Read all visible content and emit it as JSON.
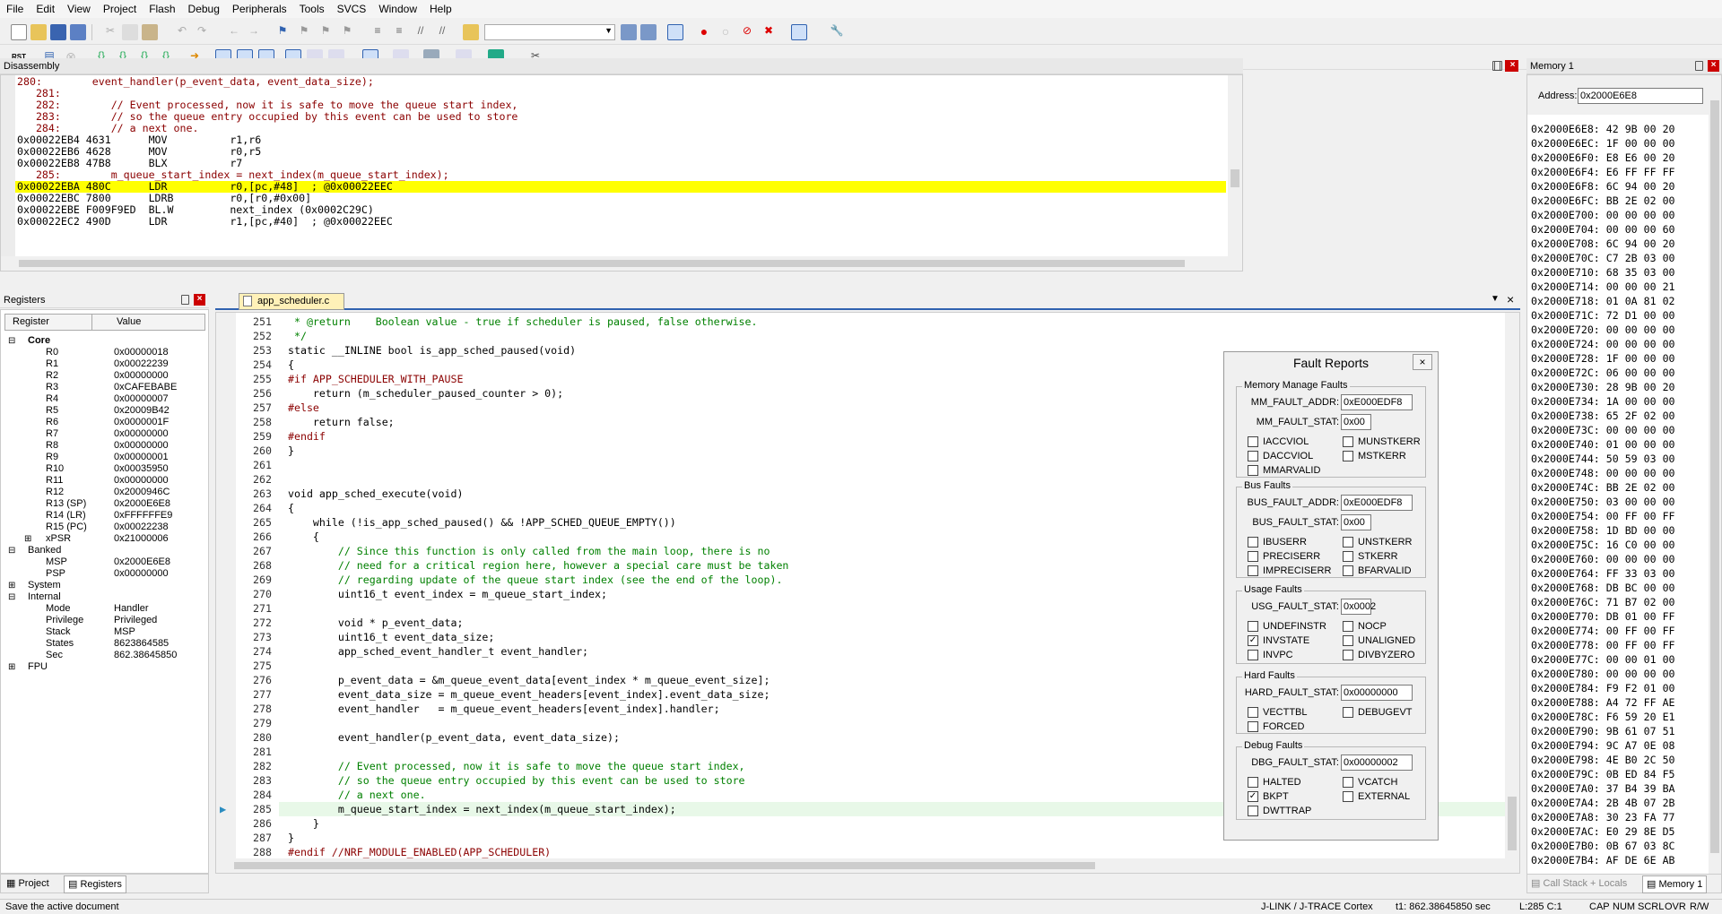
{
  "menu": [
    "File",
    "Edit",
    "View",
    "Project",
    "Flash",
    "Debug",
    "Peripherals",
    "Tools",
    "SVCS",
    "Window",
    "Help"
  ],
  "disassembly": {
    "title": "Disassembly",
    "lines": [
      {
        "t": "280:        event_handler(p_event_data, event_data_size);",
        "c": "cd"
      },
      {
        "t": "   281:",
        "c": "cd"
      },
      {
        "t": "   282:        // Event processed, now it is safe to move the queue start index,",
        "c": "cd"
      },
      {
        "t": "   283:        // so the queue entry occupied by this event can be used to store",
        "c": "cd"
      },
      {
        "t": "   284:        // a next one.",
        "c": "cd"
      },
      {
        "t": "0x00022EB4 4631      MOV          r1,r6",
        "c": ""
      },
      {
        "t": "0x00022EB6 4628      MOV          r0,r5",
        "c": ""
      },
      {
        "t": "0x00022EB8 47B8      BLX          r7",
        "c": ""
      },
      {
        "t": "   285:        m_queue_start_index = next_index(m_queue_start_index);",
        "c": "cd"
      },
      {
        "t": "0x00022EBA 480C      LDR          r0,[pc,#48]  ; @0x00022EEC",
        "c": "hl"
      },
      {
        "t": "0x00022EBC 7800      LDRB         r0,[r0,#0x00]",
        "c": ""
      },
      {
        "t": "0x00022EBE F009F9ED  BL.W         next_index (0x0002C29C)",
        "c": ""
      },
      {
        "t": "0x00022EC2 490D      LDR          r1,[pc,#40]  ; @0x00022EEC",
        "c": ""
      }
    ]
  },
  "registers": {
    "title": "Registers",
    "col_register": "Register",
    "col_value": "Value",
    "rows": [
      {
        "n": "Core",
        "v": "",
        "lvl": 0,
        "bold": true,
        "exp": "-"
      },
      {
        "n": "R0",
        "v": "0x00000018",
        "lvl": 1
      },
      {
        "n": "R1",
        "v": "0x00022239",
        "lvl": 1
      },
      {
        "n": "R2",
        "v": "0x00000000",
        "lvl": 1
      },
      {
        "n": "R3",
        "v": "0xCAFEBABE",
        "lvl": 1
      },
      {
        "n": "R4",
        "v": "0x00000007",
        "lvl": 1
      },
      {
        "n": "R5",
        "v": "0x20009B42",
        "lvl": 1
      },
      {
        "n": "R6",
        "v": "0x0000001F",
        "lvl": 1
      },
      {
        "n": "R7",
        "v": "0x00000000",
        "lvl": 1
      },
      {
        "n": "R8",
        "v": "0x00000000",
        "lvl": 1
      },
      {
        "n": "R9",
        "v": "0x00000001",
        "lvl": 1
      },
      {
        "n": "R10",
        "v": "0x00035950",
        "lvl": 1
      },
      {
        "n": "R11",
        "v": "0x00000000",
        "lvl": 1
      },
      {
        "n": "R12",
        "v": "0x2000946C",
        "lvl": 1
      },
      {
        "n": "R13 (SP)",
        "v": "0x2000E6E8",
        "lvl": 1
      },
      {
        "n": "R14 (LR)",
        "v": "0xFFFFFFE9",
        "lvl": 1
      },
      {
        "n": "R15 (PC)",
        "v": "0x00022238",
        "lvl": 1
      },
      {
        "n": "xPSR",
        "v": "0x21000006",
        "lvl": 1,
        "exp": "+"
      },
      {
        "n": "Banked",
        "v": "",
        "lvl": 0,
        "exp": "-"
      },
      {
        "n": "MSP",
        "v": "0x2000E6E8",
        "lvl": 1
      },
      {
        "n": "PSP",
        "v": "0x00000000",
        "lvl": 1
      },
      {
        "n": "System",
        "v": "",
        "lvl": 0,
        "exp": "+"
      },
      {
        "n": "Internal",
        "v": "",
        "lvl": 0,
        "exp": "-"
      },
      {
        "n": "Mode",
        "v": "Handler",
        "lvl": 1
      },
      {
        "n": "Privilege",
        "v": "Privileged",
        "lvl": 1
      },
      {
        "n": "Stack",
        "v": "MSP",
        "lvl": 1
      },
      {
        "n": "States",
        "v": "8623864585",
        "lvl": 1
      },
      {
        "n": "Sec",
        "v": "862.38645850",
        "lvl": 1
      },
      {
        "n": "FPU",
        "v": "",
        "lvl": 0,
        "exp": "+"
      }
    ],
    "tab_project": "Project",
    "tab_registers": "Registers"
  },
  "editor": {
    "tab": "app_scheduler.c",
    "lines": [
      {
        "n": "251",
        "h": " * @return    Boolean value - true if scheduler is paused, false otherwise.",
        "k": "cmt"
      },
      {
        "n": "252",
        "h": " */",
        "k": "cmt"
      },
      {
        "n": "253",
        "h": "static __INLINE bool is_app_sched_paused(void)",
        "k": ""
      },
      {
        "n": "254",
        "h": "{",
        "k": ""
      },
      {
        "n": "255",
        "h": "#if APP_SCHEDULER_WITH_PAUSE",
        "k": "pp"
      },
      {
        "n": "256",
        "h": "    return (m_scheduler_paused_counter > 0);",
        "k": ""
      },
      {
        "n": "257",
        "h": "#else",
        "k": "pp"
      },
      {
        "n": "258",
        "h": "    return false;",
        "k": ""
      },
      {
        "n": "259",
        "h": "#endif",
        "k": "pp"
      },
      {
        "n": "260",
        "h": "}",
        "k": ""
      },
      {
        "n": "261",
        "h": "",
        "k": ""
      },
      {
        "n": "262",
        "h": "",
        "k": ""
      },
      {
        "n": "263",
        "h": "void app_sched_execute(void)",
        "k": ""
      },
      {
        "n": "264",
        "h": "{",
        "k": ""
      },
      {
        "n": "265",
        "h": "    while (!is_app_sched_paused() && !APP_SCHED_QUEUE_EMPTY())",
        "k": ""
      },
      {
        "n": "266",
        "h": "    {",
        "k": ""
      },
      {
        "n": "267",
        "h": "        // Since this function is only called from the main loop, there is no",
        "k": "cmt"
      },
      {
        "n": "268",
        "h": "        // need for a critical region here, however a special care must be taken",
        "k": "cmt"
      },
      {
        "n": "269",
        "h": "        // regarding update of the queue start index (see the end of the loop).",
        "k": "cmt"
      },
      {
        "n": "270",
        "h": "        uint16_t event_index = m_queue_start_index;",
        "k": ""
      },
      {
        "n": "271",
        "h": "",
        "k": ""
      },
      {
        "n": "272",
        "h": "        void * p_event_data;",
        "k": ""
      },
      {
        "n": "273",
        "h": "        uint16_t event_data_size;",
        "k": ""
      },
      {
        "n": "274",
        "h": "        app_sched_event_handler_t event_handler;",
        "k": ""
      },
      {
        "n": "275",
        "h": "",
        "k": ""
      },
      {
        "n": "276",
        "h": "        p_event_data = &m_queue_event_data[event_index * m_queue_event_size];",
        "k": ""
      },
      {
        "n": "277",
        "h": "        event_data_size = m_queue_event_headers[event_index].event_data_size;",
        "k": ""
      },
      {
        "n": "278",
        "h": "        event_handler   = m_queue_event_headers[event_index].handler;",
        "k": ""
      },
      {
        "n": "279",
        "h": "",
        "k": ""
      },
      {
        "n": "280",
        "h": "        event_handler(p_event_data, event_data_size);",
        "k": ""
      },
      {
        "n": "281",
        "h": "",
        "k": ""
      },
      {
        "n": "282",
        "h": "        // Event processed, now it is safe to move the queue start index,",
        "k": "cmt"
      },
      {
        "n": "283",
        "h": "        // so the queue entry occupied by this event can be used to store",
        "k": "cmt"
      },
      {
        "n": "284",
        "h": "        // a next one.",
        "k": "cmt"
      },
      {
        "n": "285",
        "h": "        m_queue_start_index = next_index(m_queue_start_index);",
        "k": "cur"
      },
      {
        "n": "286",
        "h": "    }",
        "k": ""
      },
      {
        "n": "287",
        "h": "}",
        "k": ""
      },
      {
        "n": "288",
        "h": "#endif //NRF_MODULE_ENABLED(APP_SCHEDULER)",
        "k": "pp"
      },
      {
        "n": "289",
        "h": "",
        "k": ""
      }
    ]
  },
  "memory": {
    "title": "Memory 1",
    "address_label": "Address:",
    "address_value": "0x2000E6E8",
    "rows": [
      "0x2000E6E8: 42 9B 00 20",
      "0x2000E6EC: 1F 00 00 00",
      "0x2000E6F0: E8 E6 00 20",
      "0x2000E6F4: E6 FF FF FF",
      "0x2000E6F8: 6C 94 00 20",
      "0x2000E6FC: BB 2E 02 00",
      "0x2000E700: 00 00 00 00",
      "0x2000E704: 00 00 00 60",
      "0x2000E708: 6C 94 00 20",
      "0x2000E70C: C7 2B 03 00",
      "0x2000E710: 68 35 03 00",
      "0x2000E714: 00 00 00 21",
      "0x2000E718: 01 0A 81 02",
      "0x2000E71C: 72 D1 00 00",
      "0x2000E720: 00 00 00 00",
      "0x2000E724: 00 00 00 00",
      "0x2000E728: 1F 00 00 00",
      "0x2000E72C: 06 00 00 00",
      "0x2000E730: 28 9B 00 20",
      "0x2000E734: 1A 00 00 00",
      "0x2000E738: 65 2F 02 00",
      "0x2000E73C: 00 00 00 00",
      "0x2000E740: 01 00 00 00",
      "0x2000E744: 50 59 03 00",
      "0x2000E748: 00 00 00 00",
      "0x2000E74C: BB 2E 02 00",
      "0x2000E750: 03 00 00 00",
      "0x2000E754: 00 FF 00 FF",
      "0x2000E758: 1D BD 00 00",
      "0x2000E75C: 16 C0 00 00",
      "0x2000E760: 00 00 00 00",
      "0x2000E764: FF 33 03 00",
      "0x2000E768: DB BC 00 00",
      "0x2000E76C: 71 B7 02 00",
      "0x2000E770: DB 01 00 FF",
      "0x2000E774: 00 FF 00 FF",
      "0x2000E778: 00 FF 00 FF",
      "0x2000E77C: 00 00 01 00",
      "0x2000E780: 00 00 00 00",
      "0x2000E784: F9 F2 01 00",
      "0x2000E788: A4 72 FF AE",
      "0x2000E78C: F6 59 20 E1",
      "0x2000E790: 9B 61 07 51",
      "0x2000E794: 9C A7 0E 08",
      "0x2000E798: 4E B0 2C 50",
      "0x2000E79C: 0B ED 84 F5",
      "0x2000E7A0: 37 B4 39 BA",
      "0x2000E7A4: 2B 4B 07 2B",
      "0x2000E7A8: 30 23 FA 77",
      "0x2000E7AC: E0 29 8E D5",
      "0x2000E7B0: 0B 67 03 8C",
      "0x2000E7B4: AF DE 6E AB"
    ],
    "tab_callstack": "Call Stack + Locals",
    "tab_memory": "Memory 1"
  },
  "fault": {
    "title": "Fault Reports",
    "mm": {
      "title": "Memory Manage Faults",
      "addr_label": "MM_FAULT_ADDR:",
      "addr": "0xE000EDF8",
      "stat_label": "MM_FAULT_STAT:",
      "stat": "0x00",
      "checks": [
        {
          "l": "IACCVIOL",
          "c": false
        },
        {
          "l": "MUNSTKERR",
          "c": false
        },
        {
          "l": "DACCVIOL",
          "c": false
        },
        {
          "l": "MSTKERR",
          "c": false
        },
        {
          "l": "MMARVALID",
          "c": false
        }
      ]
    },
    "bus": {
      "title": "Bus Faults",
      "addr_label": "BUS_FAULT_ADDR:",
      "addr": "0xE000EDF8",
      "stat_label": "BUS_FAULT_STAT:",
      "stat": "0x00",
      "checks": [
        {
          "l": "IBUSERR",
          "c": false
        },
        {
          "l": "UNSTKERR",
          "c": false
        },
        {
          "l": "PRECISERR",
          "c": false
        },
        {
          "l": "STKERR",
          "c": false
        },
        {
          "l": "IMPRECISERR",
          "c": false
        },
        {
          "l": "BFARVALID",
          "c": false
        }
      ]
    },
    "usg": {
      "title": "Usage Faults",
      "stat_label": "USG_FAULT_STAT:",
      "stat": "0x0002",
      "checks": [
        {
          "l": "UNDEFINSTR",
          "c": false
        },
        {
          "l": "NOCP",
          "c": false
        },
        {
          "l": "INVSTATE",
          "c": true
        },
        {
          "l": "UNALIGNED",
          "c": false
        },
        {
          "l": "INVPC",
          "c": false
        },
        {
          "l": "DIVBYZERO",
          "c": false
        }
      ]
    },
    "hard": {
      "title": "Hard Faults",
      "stat_label": "HARD_FAULT_STAT:",
      "stat": "0x00000000",
      "checks": [
        {
          "l": "VECTTBL",
          "c": false
        },
        {
          "l": "DEBUGEVT",
          "c": false
        },
        {
          "l": "FORCED",
          "c": false
        }
      ]
    },
    "dbg": {
      "title": "Debug Faults",
      "stat_label": "DBG_FAULT_STAT:",
      "stat": "0x00000002",
      "checks": [
        {
          "l": "HALTED",
          "c": false
        },
        {
          "l": "VCATCH",
          "c": false
        },
        {
          "l": "BKPT",
          "c": true
        },
        {
          "l": "EXTERNAL",
          "c": false
        },
        {
          "l": "DWTTRAP",
          "c": false
        }
      ]
    }
  },
  "status": {
    "left": "Save the active document",
    "debugger": "J-LINK / J-TRACE Cortex",
    "time": "t1: 862.38645850 sec",
    "pos": "L:285 C:1",
    "keys": [
      "CAP",
      "NUM",
      "SCRL",
      "OVR",
      "R/W"
    ]
  },
  "colors": {
    "highlight": "#ffff00",
    "current_line": "#e8f8e8",
    "accent": "#cc0000"
  }
}
